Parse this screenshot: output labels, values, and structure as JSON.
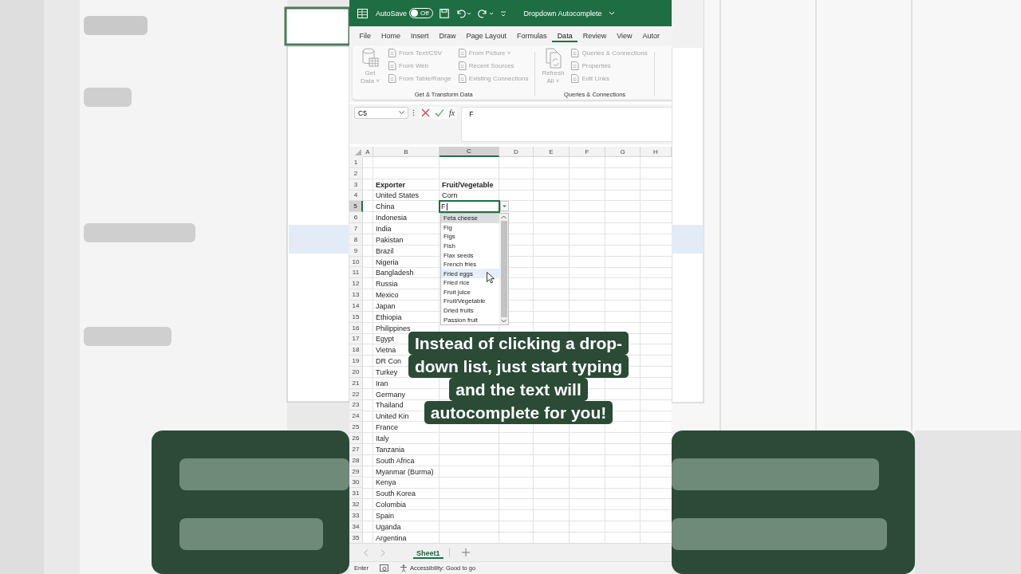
{
  "title_bar": {
    "autosave_label": "AutoSave",
    "autosave_state": "Off",
    "autosave_on": false,
    "document_title": "Dropdown Autocomplete"
  },
  "ribbon_tabs": [
    {
      "label": "File",
      "selected": false
    },
    {
      "label": "Home",
      "selected": false
    },
    {
      "label": "Insert",
      "selected": false
    },
    {
      "label": "Draw",
      "selected": false
    },
    {
      "label": "Page Layout",
      "selected": false
    },
    {
      "label": "Formulas",
      "selected": false
    },
    {
      "label": "Data",
      "selected": true
    },
    {
      "label": "Review",
      "selected": false
    },
    {
      "label": "View",
      "selected": false
    },
    {
      "label": "Autor",
      "selected": false
    }
  ],
  "ribbon_groups": [
    {
      "title": "Get & Transform Data",
      "big_button": {
        "lines": [
          "Get",
          "Data ˅"
        ],
        "disabled": true
      },
      "columns": [
        [
          {
            "label": "From Text/CSV",
            "disabled": true
          },
          {
            "label": "From Web",
            "disabled": true
          },
          {
            "label": "From Table/Range",
            "disabled": true
          }
        ],
        [
          {
            "label": "From Picture ˅",
            "disabled": true
          },
          {
            "label": "Recent Sources",
            "disabled": true
          },
          {
            "label": "Existing Connections",
            "disabled": true
          }
        ]
      ]
    },
    {
      "title": "Queries & Connections",
      "big_button": {
        "lines": [
          "Refresh",
          "All ˅"
        ],
        "disabled": true
      },
      "columns": [
        [
          {
            "label": "Queries & Connections",
            "disabled": true
          },
          {
            "label": "Properties",
            "disabled": true
          },
          {
            "label": "Edit Links",
            "disabled": true
          }
        ]
      ]
    }
  ],
  "formula_bar": {
    "name_box": "C5",
    "insert_function": "fx",
    "value": "F"
  },
  "columns": [
    {
      "label": "A",
      "selected": false
    },
    {
      "label": "B",
      "selected": false
    },
    {
      "label": "C",
      "selected": true
    },
    {
      "label": "D",
      "selected": false
    },
    {
      "label": "E",
      "selected": false
    },
    {
      "label": "F",
      "selected": false
    },
    {
      "label": "G",
      "selected": false
    },
    {
      "label": "H",
      "selected": false
    }
  ],
  "rows": [
    {
      "number": "1",
      "selected": false
    },
    {
      "number": "2",
      "selected": false
    },
    {
      "number": "3",
      "kind": "header",
      "b": "Exporter",
      "c": "Fruit/Vegetable",
      "selected": false
    },
    {
      "number": "4",
      "b": "United States",
      "c": "Corn",
      "selected": false
    },
    {
      "number": "5",
      "b": "China",
      "c": "F",
      "editing": true,
      "selected": true
    },
    {
      "number": "6",
      "b": "Indonesia",
      "selected": false
    },
    {
      "number": "7",
      "b": "India",
      "selected": false
    },
    {
      "number": "8",
      "b": "Pakistan",
      "selected": false
    },
    {
      "number": "9",
      "b": "Brazil",
      "selected": false
    },
    {
      "number": "10",
      "b": "Nigeria",
      "selected": false
    },
    {
      "number": "11",
      "b": "Bangladesh",
      "selected": false
    },
    {
      "number": "12",
      "b": "Russia",
      "selected": false
    },
    {
      "number": "13",
      "b": "Mexico",
      "selected": false
    },
    {
      "number": "14",
      "b": "Japan",
      "selected": false
    },
    {
      "number": "15",
      "b": "Ethiopia",
      "selected": false
    },
    {
      "number": "16",
      "b": "Philippines",
      "selected": false
    },
    {
      "number": "17",
      "b": "Egypt",
      "selected": false
    },
    {
      "number": "18",
      "b": "Vietna",
      "selected": false
    },
    {
      "number": "19",
      "b": "DR Con",
      "selected": false
    },
    {
      "number": "20",
      "b": "Turkey",
      "selected": false
    },
    {
      "number": "21",
      "b": "Iran",
      "selected": false
    },
    {
      "number": "22",
      "b": "Germany",
      "selected": false
    },
    {
      "number": "23",
      "b": "Thailand",
      "selected": false
    },
    {
      "number": "24",
      "b": "United Kin",
      "selected": false
    },
    {
      "number": "25",
      "b": "France",
      "selected": false
    },
    {
      "number": "26",
      "b": "Italy",
      "selected": false
    },
    {
      "number": "27",
      "b": "Tanzania",
      "selected": false
    },
    {
      "number": "28",
      "b": "South Africa",
      "selected": false
    },
    {
      "number": "29",
      "b": "Myanmar (Burma)",
      "selected": false
    },
    {
      "number": "30",
      "b": "Kenya",
      "selected": false
    },
    {
      "number": "31",
      "b": "South Korea",
      "selected": false
    },
    {
      "number": "32",
      "b": "Colombia",
      "selected": false
    },
    {
      "number": "33",
      "b": "Spain",
      "selected": false
    },
    {
      "number": "34",
      "b": "Uganda",
      "selected": false
    },
    {
      "number": "35",
      "b": "Argentina",
      "selected": false
    }
  ],
  "dropdown": {
    "items": [
      {
        "label": "Feta cheese",
        "selected": true,
        "hovered": false
      },
      {
        "label": "Fig",
        "selected": false,
        "hovered": false
      },
      {
        "label": "Figs",
        "selected": false,
        "hovered": false
      },
      {
        "label": "Fish",
        "selected": false,
        "hovered": false
      },
      {
        "label": "Flax seeds",
        "selected": false,
        "hovered": false
      },
      {
        "label": "French fries",
        "selected": false,
        "hovered": false
      },
      {
        "label": "Fried eggs",
        "selected": false,
        "hovered": true
      },
      {
        "label": "Fried rice",
        "selected": false,
        "hovered": false
      },
      {
        "label": "Fruit juice",
        "selected": false,
        "hovered": false
      },
      {
        "label": "Fruit/Vegetable",
        "selected": false,
        "hovered": false
      },
      {
        "label": "Dried fruits",
        "selected": false,
        "hovered": false
      },
      {
        "label": "Passion fruit",
        "selected": false,
        "hovered": false
      }
    ]
  },
  "caption": {
    "lines": [
      "Instead of clicking a drop-",
      "down list, just start typing",
      "and the text will",
      "autocomplete for you!"
    ]
  },
  "sheet_tabs": [
    {
      "label": "Sheet1",
      "selected": true
    }
  ],
  "status_bar": {
    "mode": "Enter",
    "accessibility": "Accessibility: Good to go"
  }
}
